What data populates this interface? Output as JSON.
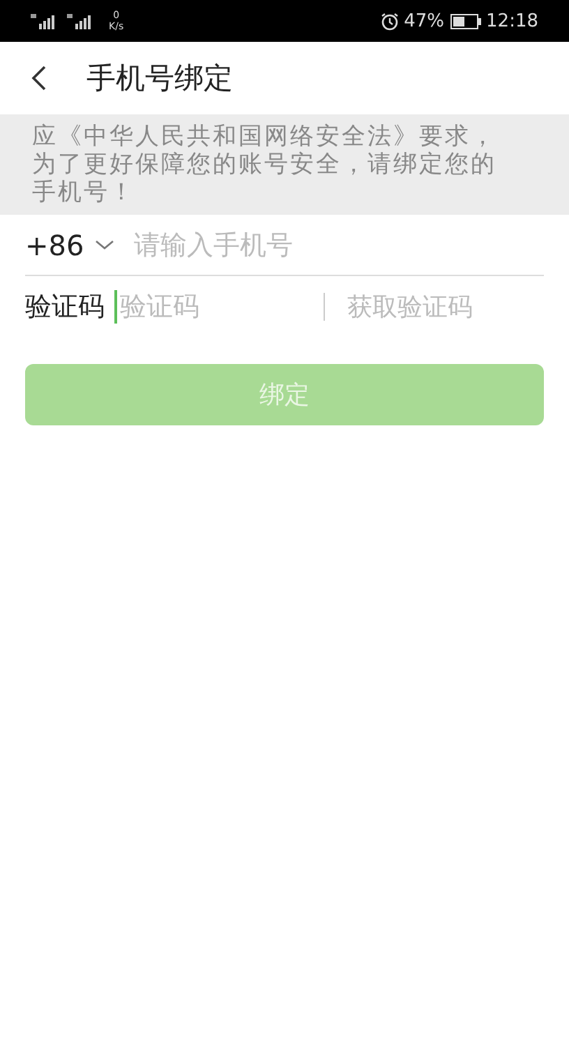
{
  "status_bar": {
    "speed_value": "0",
    "speed_unit": "K/s",
    "battery_percent": "47%",
    "time": "12:18"
  },
  "header": {
    "title": "手机号绑定"
  },
  "notice": "应《中华人民共和国网络安全法》要求，为了更好保障您的账号安全，请绑定您的手机号！",
  "phone": {
    "country_code": "+86",
    "placeholder": "请输入手机号"
  },
  "code": {
    "label": "验证码",
    "placeholder": "验证码",
    "focused": true,
    "get_code": "获取验证码"
  },
  "bind_button": {
    "label": "绑定",
    "disabled": true
  }
}
